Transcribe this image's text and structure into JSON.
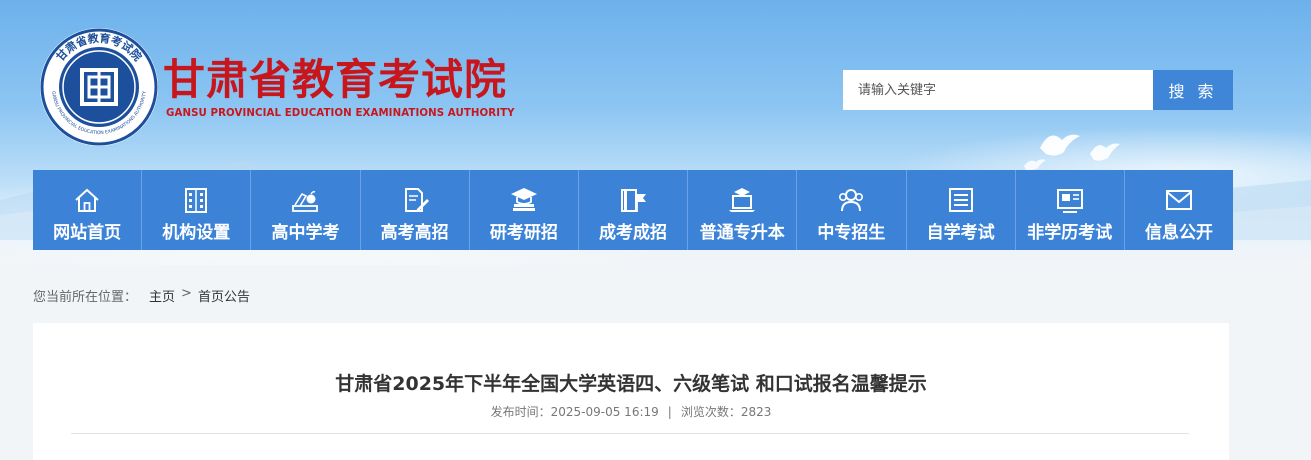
{
  "header": {
    "logo_cn": "甘肃省教育考试院",
    "logo_en": "GANSU PROVINCIAL EDUCATION EXAMINATIONS AUTHORITY",
    "seal_top_text": "甘肃省教育考试院",
    "seal_bottom_text": "GANSU PROVINCIAL EDUCATION EXAMINATIONS AUTHORITY",
    "brand_color": "#c8161d"
  },
  "search": {
    "placeholder": "请输入关键字",
    "button_label": "搜 索"
  },
  "nav": {
    "items": [
      {
        "label": "网站首页",
        "icon": "home-icon"
      },
      {
        "label": "机构设置",
        "icon": "building-icon"
      },
      {
        "label": "高中学考",
        "icon": "books-apple-icon"
      },
      {
        "label": "高考高招",
        "icon": "document-pen-icon"
      },
      {
        "label": "研考研招",
        "icon": "graduation-cap-icon"
      },
      {
        "label": "成考成招",
        "icon": "book-flag-icon"
      },
      {
        "label": "普通专升本",
        "icon": "laptop-cap-icon"
      },
      {
        "label": "中专招生",
        "icon": "users-icon"
      },
      {
        "label": "自学考试",
        "icon": "notebook-icon"
      },
      {
        "label": "非学历考试",
        "icon": "id-card-icon"
      },
      {
        "label": "信息公开",
        "icon": "mail-icon"
      }
    ],
    "bg_color": "#3c83d8"
  },
  "breadcrumb": {
    "lead": "您当前所在位置：",
    "home": "主页",
    "separator": ">",
    "current": "首页公告"
  },
  "article": {
    "title": "甘肃省2025年下半年全国大学英语四、六级笔试 和口试报名温馨提示",
    "published_label": "发布时间：",
    "published_value": "2025-09-05 16:19",
    "meta_separator": "|",
    "views_label": "浏览次数：",
    "views_value": "2823"
  }
}
